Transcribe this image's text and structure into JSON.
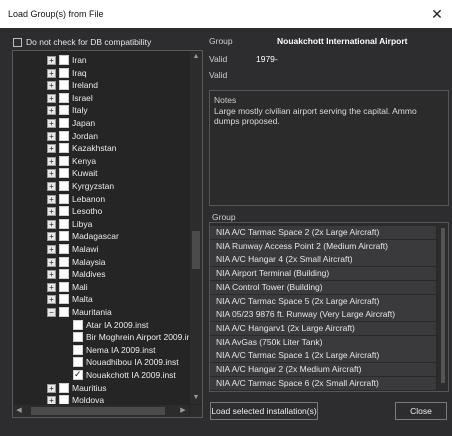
{
  "window": {
    "title": "Load Group(s) from File",
    "close_glyph": "✕"
  },
  "db_compat": {
    "label": "Do not check for DB compatibility",
    "checked": false
  },
  "tree": {
    "items": [
      {
        "label": "Iran",
        "type": "country"
      },
      {
        "label": "Iraq",
        "type": "country"
      },
      {
        "label": "Ireland",
        "type": "country"
      },
      {
        "label": "Israel",
        "type": "country"
      },
      {
        "label": "Italy",
        "type": "country"
      },
      {
        "label": "Japan",
        "type": "country"
      },
      {
        "label": "Jordan",
        "type": "country"
      },
      {
        "label": "Kazakhstan",
        "type": "country"
      },
      {
        "label": "Kenya",
        "type": "country"
      },
      {
        "label": "Kuwait",
        "type": "country"
      },
      {
        "label": "Kyrgyzstan",
        "type": "country"
      },
      {
        "label": "Lebanon",
        "type": "country"
      },
      {
        "label": "Lesotho",
        "type": "country"
      },
      {
        "label": "Libya",
        "type": "country"
      },
      {
        "label": "Madagascar",
        "type": "country"
      },
      {
        "label": "Malawi",
        "type": "country"
      },
      {
        "label": "Malaysia",
        "type": "country"
      },
      {
        "label": "Maldives",
        "type": "country"
      },
      {
        "label": "Mali",
        "type": "country"
      },
      {
        "label": "Malta",
        "type": "country"
      },
      {
        "label": "Mauritania",
        "type": "expanded"
      },
      {
        "label": "Atar IA 2009.inst",
        "type": "file",
        "checked": false
      },
      {
        "label": "Bir Moghrein Airport 2009.ins",
        "type": "file",
        "checked": false
      },
      {
        "label": "Nema IA 2009.inst",
        "type": "file",
        "checked": false
      },
      {
        "label": "Nouadhibou IA 2009.inst",
        "type": "file",
        "checked": false
      },
      {
        "label": "Nouakchott IA 2009.inst",
        "type": "file",
        "checked": true
      },
      {
        "label": "Mauritius",
        "type": "country"
      },
      {
        "label": "Moldova",
        "type": "country"
      }
    ]
  },
  "details": {
    "group_label": "Group",
    "group_value": "Nouakchott International Airport",
    "valid_label": "Valid",
    "valid_value": "1979-",
    "valid2_label": "Valid"
  },
  "notes": {
    "label": "Notes",
    "text": "Large mostly civilian airport serving the capital. Ammo dumps proposed."
  },
  "group_list": {
    "label": "Group",
    "items": [
      "NIA A/C Tarmac Space 2 (2x Large Aircraft)",
      "NIA Runway Access Point 2 (Medium Aircraft)",
      "NIA A/C Hangar 4 (2x Small Aircraft)",
      "NIA Airport Terminal (Building)",
      "NIA Control Tower (Building)",
      "NIA A/C Tarmac Space 5 (2x Large Aircraft)",
      "NIA 05/23 9876 ft. Runway (Very Large Aircraft)",
      "NIA A/C Hangarv1 (2x Large Aircraft)",
      "NIA AvGas (750k Liter Tank)",
      "NIA A/C Tarmac Space 1 (2x Large Aircraft)",
      "NIA A/C Hangar 2 (2x Medium Aircraft)",
      "NIA A/C Tarmac Space 6 (2x Small Aircraft)"
    ]
  },
  "buttons": {
    "load": "Load selected installation(s)",
    "close": "Close"
  },
  "colors": {
    "background": "#2d2d30",
    "titlebar": "#ffffff",
    "list_item": "#3a3a3d",
    "text": "#e6e6e6"
  },
  "icons": {
    "expand": "plus-box-icon",
    "collapse": "minus-box-icon"
  }
}
